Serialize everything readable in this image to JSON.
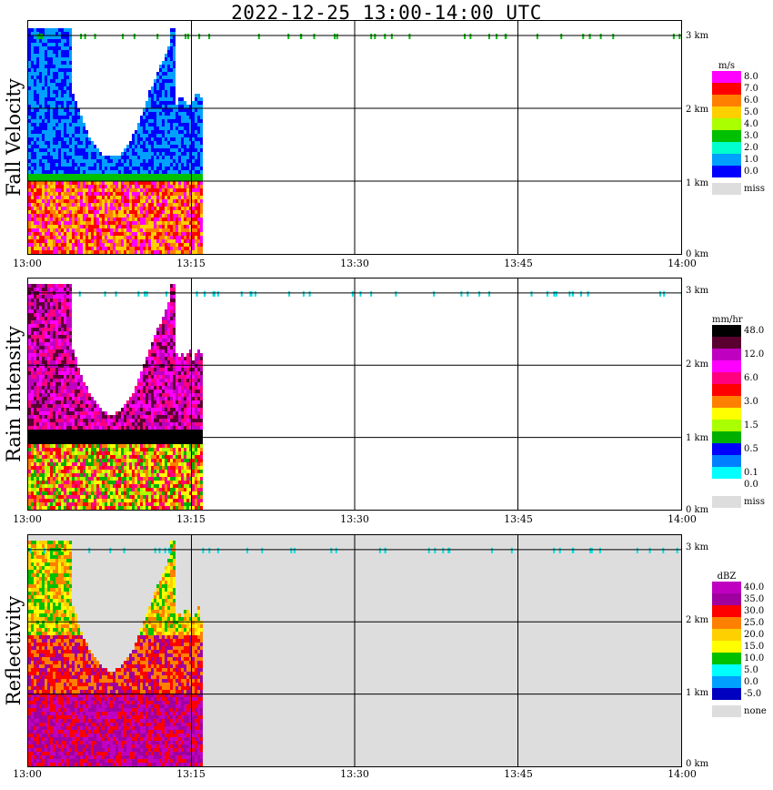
{
  "title": "2022-12-25  13:00-14:00 UTC",
  "x_ticks": [
    "13:00",
    "13:15",
    "13:30",
    "13:45",
    "14:00"
  ],
  "alt_ticks": [
    "3 km",
    "2 km",
    "1 km",
    "0 km"
  ],
  "panels": [
    {
      "label": "Fall Velocity",
      "unit": "m/s",
      "legend": [
        {
          "color": "#ff00ff",
          "label": "8.0"
        },
        {
          "color": "#ff0000",
          "label": "7.0"
        },
        {
          "color": "#ff7f00",
          "label": "6.0"
        },
        {
          "color": "#ffcf00",
          "label": "5.0"
        },
        {
          "color": "#aaff00",
          "label": "4.0"
        },
        {
          "color": "#00c000",
          "label": "3.0"
        },
        {
          "color": "#00ffcc",
          "label": "2.0"
        },
        {
          "color": "#00a0ff",
          "label": "1.0"
        },
        {
          "color": "#0000ff",
          "label": "0.0"
        }
      ],
      "missing_label": "miss",
      "missing_color": "#dddddd"
    },
    {
      "label": "Rain Intensity",
      "unit": "mm/hr",
      "legend": [
        {
          "color": "#000000",
          "label": "48.0"
        },
        {
          "color": "#5a0030",
          "label": ""
        },
        {
          "color": "#c000c0",
          "label": "12.0"
        },
        {
          "color": "#ff00ff",
          "label": ""
        },
        {
          "color": "#ff007f",
          "label": "6.0"
        },
        {
          "color": "#ff0000",
          "label": ""
        },
        {
          "color": "#ff8000",
          "label": "3.0"
        },
        {
          "color": "#ffff00",
          "label": ""
        },
        {
          "color": "#aaff00",
          "label": "1.5"
        },
        {
          "color": "#00b000",
          "label": ""
        },
        {
          "color": "#0000ff",
          "label": "0.5"
        },
        {
          "color": "#0080ff",
          "label": ""
        },
        {
          "color": "#00ffff",
          "label": "0.1"
        },
        {
          "color": "#ffffff",
          "label": "0.0"
        }
      ],
      "missing_label": "miss",
      "missing_color": "#dddddd"
    },
    {
      "label": "Reflectivity",
      "unit": "dBZ",
      "legend": [
        {
          "color": "#c000c0",
          "label": "40.0"
        },
        {
          "color": "#a000a0",
          "label": "35.0"
        },
        {
          "color": "#ff0000",
          "label": "30.0"
        },
        {
          "color": "#ff8000",
          "label": "25.0"
        },
        {
          "color": "#ffd000",
          "label": "20.0"
        },
        {
          "color": "#ffff00",
          "label": "15.0"
        },
        {
          "color": "#00c000",
          "label": "10.0"
        },
        {
          "color": "#00ffff",
          "label": "5.0"
        },
        {
          "color": "#00a0ff",
          "label": "0.0"
        },
        {
          "color": "#0000c0",
          "label": "-5.0"
        }
      ],
      "missing_label": "none",
      "missing_color": "#dddddd"
    }
  ],
  "chart_data": [
    {
      "type": "heatmap",
      "title": "2022-12-25  13:00-14:00 UTC",
      "ylabel": "Fall Velocity",
      "units": "m/s",
      "xlim": [
        "13:00",
        "14:00"
      ],
      "ylim_km": [
        0,
        3.2
      ],
      "echo_end_time": "13:16",
      "melting_layer_km": 1.0
    },
    {
      "type": "heatmap",
      "ylabel": "Rain Intensity",
      "units": "mm/hr",
      "xlim": [
        "13:00",
        "14:00"
      ],
      "ylim_km": [
        0,
        3.2
      ],
      "echo_end_time": "13:16",
      "melting_layer_km": 1.0
    },
    {
      "type": "heatmap",
      "ylabel": "Reflectivity",
      "units": "dBZ",
      "xlim": [
        "13:00",
        "14:00"
      ],
      "ylim_km": [
        0,
        3.2
      ],
      "echo_end_time": "13:16",
      "melting_layer_km": 1.0
    }
  ]
}
